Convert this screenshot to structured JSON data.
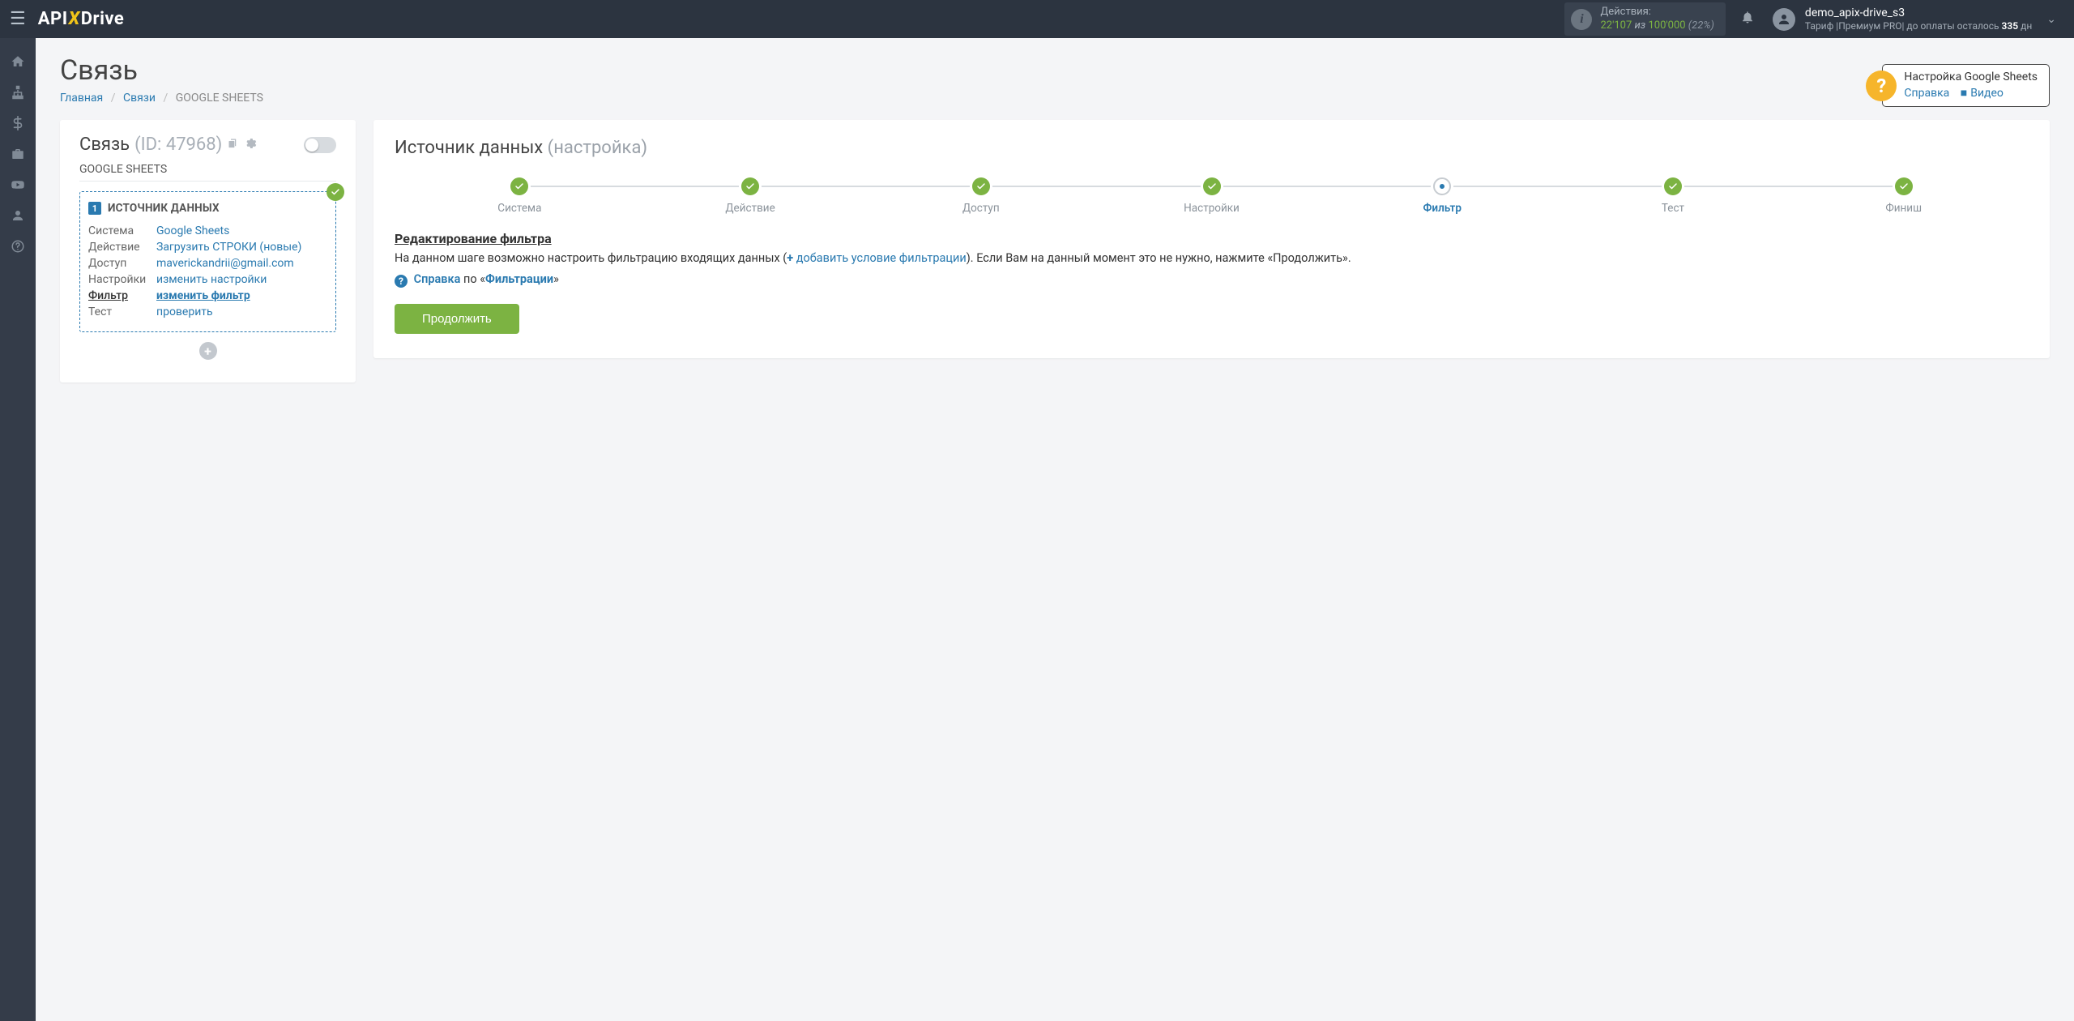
{
  "header": {
    "logo": {
      "p1": "API",
      "p2": "X",
      "p3": "Drive"
    },
    "actions": {
      "label": "Действия:",
      "used": "22'107",
      "of": "из",
      "total": "100'000",
      "pct": "(22%)"
    },
    "user": {
      "name": "demo_apix-drive_s3",
      "plan_prefix": "Тариф |Премиум PRO| до оплаты осталось ",
      "days": "335",
      "suffix": " дн"
    }
  },
  "sidebar": {
    "items": [
      {
        "name": "home-icon"
      },
      {
        "name": "sitemap-icon"
      },
      {
        "name": "dollar-icon"
      },
      {
        "name": "briefcase-icon"
      },
      {
        "name": "youtube-icon"
      },
      {
        "name": "user-icon"
      },
      {
        "name": "help-icon"
      }
    ]
  },
  "page": {
    "title": "Связь",
    "breadcrumb": {
      "home": "Главная",
      "links": "Связи",
      "current": "GOOGLE SHEETS"
    },
    "help": {
      "title": "Настройка Google Sheets",
      "ref": "Справка",
      "video": "Видео"
    }
  },
  "left": {
    "title": "Связь",
    "id": "(ID: 47968)",
    "sub": "GOOGLE SHEETS",
    "source": {
      "badge": "1",
      "heading": "ИСТОЧНИК ДАННЫХ",
      "rows": [
        {
          "k": "Система",
          "v": "Google Sheets",
          "active": false
        },
        {
          "k": "Действие",
          "v": "Загрузить СТРОКИ (новые)",
          "active": false
        },
        {
          "k": "Доступ",
          "v": "maverickandrii@gmail.com",
          "active": false
        },
        {
          "k": "Настройки",
          "v": "изменить настройки",
          "active": false
        },
        {
          "k": "Фильтр",
          "v": "изменить фильтр",
          "active": true
        },
        {
          "k": "Тест",
          "v": "проверить",
          "active": false
        }
      ]
    }
  },
  "right": {
    "title": "Источник данных",
    "subtitle": "(настройка)",
    "steps": [
      {
        "label": "Система",
        "state": "done"
      },
      {
        "label": "Действие",
        "state": "done"
      },
      {
        "label": "Доступ",
        "state": "done"
      },
      {
        "label": "Настройки",
        "state": "done"
      },
      {
        "label": "Фильтр",
        "state": "current"
      },
      {
        "label": "Тест",
        "state": "done"
      },
      {
        "label": "Финиш",
        "state": "done"
      }
    ],
    "section_h": "Редактирование фильтра",
    "section_p1": "На данном шаге возможно настроить фильтрацию входящих данных (",
    "section_link": "добавить условие фильтрации",
    "section_p2": "). Если Вам на данный момент это не нужно, нажмите «Продолжить».",
    "help_ref": "Справка",
    "help_mid": " по «",
    "help_topic": "Фильтрации",
    "help_end": "»",
    "btn": "Продолжить"
  }
}
